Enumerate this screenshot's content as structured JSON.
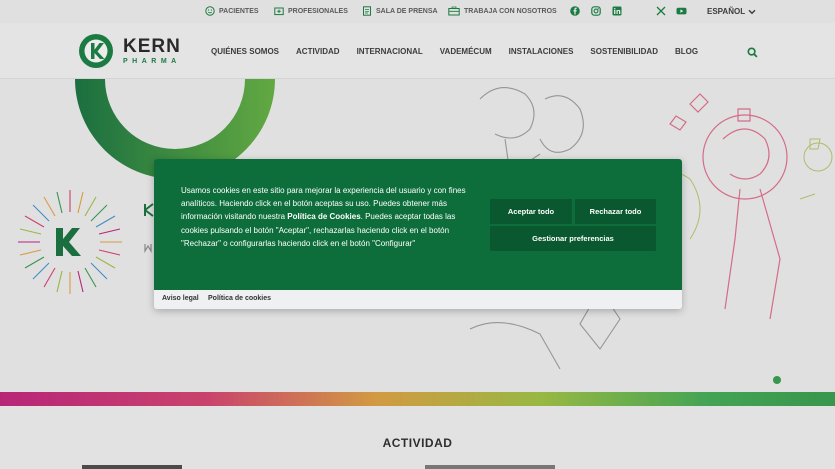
{
  "topbar": {
    "links": [
      {
        "label": "PACIENTES",
        "icon": "smiley-icon"
      },
      {
        "label": "PROFESIONALES",
        "icon": "medical-case-icon"
      },
      {
        "label": "SALA DE PRENSA",
        "icon": "document-icon"
      },
      {
        "label": "TRABAJA CON NOSOTROS",
        "icon": "briefcase-icon"
      }
    ],
    "social": [
      "facebook-icon",
      "instagram-icon",
      "linkedin-icon",
      "x-icon",
      "youtube-icon"
    ],
    "language": "ESPAÑOL"
  },
  "brand": {
    "name": "KERN",
    "tagline": "PHARMA",
    "color": "#0c7c3a"
  },
  "nav": {
    "items": [
      "QUIÉNES SOMOS",
      "ACTIVIDAD",
      "INTERNACIONAL",
      "VADEMÉCUM",
      "INSTALACIONES",
      "SOSTENIBILIDAD",
      "BLOG"
    ]
  },
  "cookie": {
    "text_part1": "Usamos cookies en este sitio para mejorar la experiencia del usuario y con fines analíticos. Haciendo click en el botón aceptas su uso. Puedes obtener más información visitando nuestra ",
    "link": "Política de Cookies",
    "text_part2": ". Puedes aceptar todas las cookies pulsando el botón \"Aceptar\", rechazarlas haciendo click en el botón \"Rechazar\" o configurarlas haciendo click en el botón \"Configurar\"",
    "accept": "Aceptar todo",
    "reject": "Rechazar todo",
    "manage": "Gestionar preferencias",
    "footer_links": [
      "Aviso legal",
      "Política de cookies"
    ]
  },
  "section": {
    "title": "ACTIVIDAD"
  },
  "colors": {
    "green": "#0d6e3b",
    "button": "#09582f"
  }
}
